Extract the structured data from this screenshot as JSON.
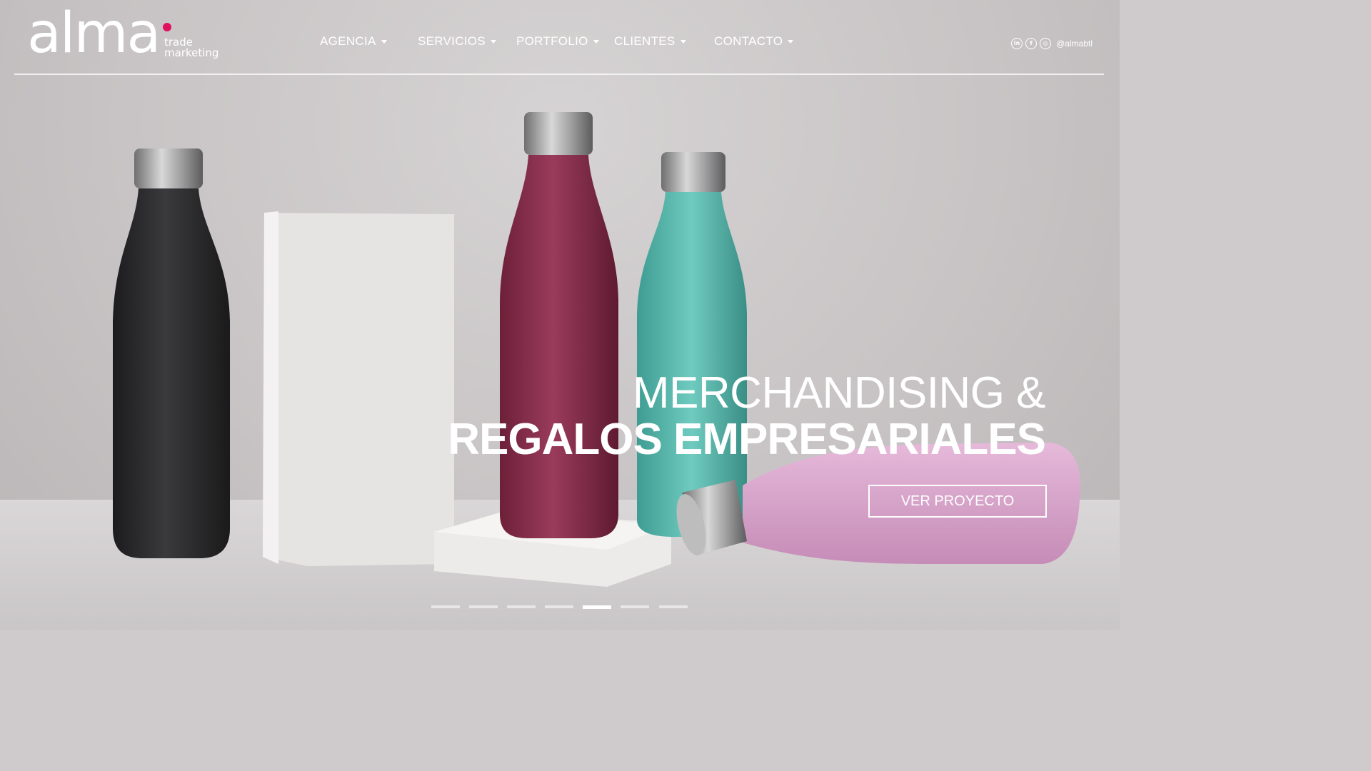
{
  "logo": {
    "word": "alma",
    "line1": "trade",
    "line2": "marketing",
    "accent": "#e0115f"
  },
  "nav": [
    {
      "label": "AGENCIA"
    },
    {
      "label": "SERVICIOS"
    },
    {
      "label": "PORTFOLIO"
    },
    {
      "label": "CLIENTES"
    },
    {
      "label": "CONTACTO"
    }
  ],
  "social": {
    "icons": [
      "linkedin-icon",
      "facebook-icon",
      "instagram-icon"
    ],
    "handle": "@almabtl"
  },
  "hero": {
    "line1": "MERCHANDISING &",
    "line2": "REGALOS EMPRESARIALES",
    "cta": "VER PROYECTO"
  },
  "slider": {
    "total": 7,
    "active": 5
  },
  "colors": {
    "bottle_black": "#2a2a2c",
    "bottle_wine": "#8a2f4d",
    "bottle_teal": "#6ec9bd",
    "bottle_pink": "#dca8cf"
  }
}
